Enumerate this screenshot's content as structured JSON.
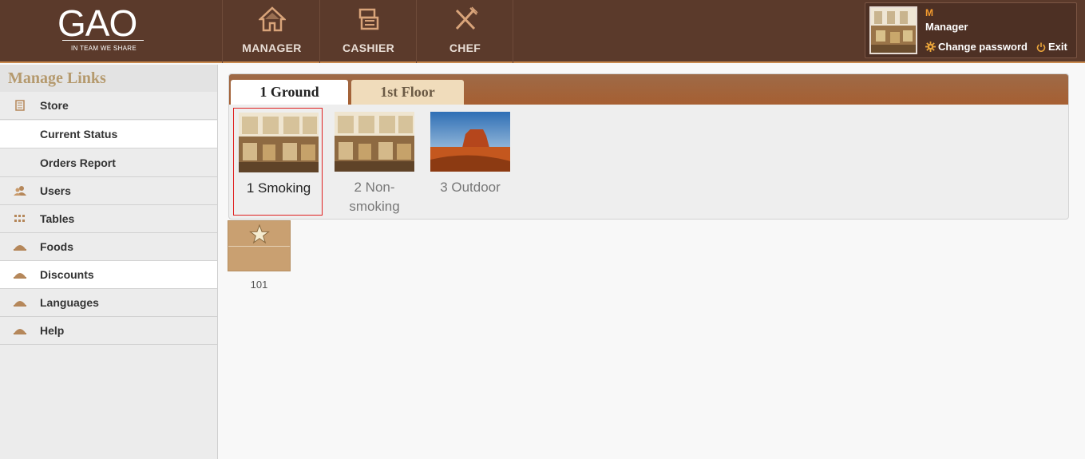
{
  "header": {
    "logo_text": "GAO",
    "logo_tagline": "IN TEAM WE SHARE",
    "nav": [
      {
        "label": "MANAGER",
        "icon": "home-icon"
      },
      {
        "label": "CASHIER",
        "icon": "cash-register-icon"
      },
      {
        "label": "CHEF",
        "icon": "fork-knife-icon"
      }
    ],
    "user": {
      "initial": "M",
      "name": "Manager",
      "change_password": "Change password",
      "exit": "Exit"
    }
  },
  "sidebar": {
    "title": "Manage Links",
    "items": [
      {
        "label": "Store",
        "icon": "store-icon"
      },
      {
        "label": "Current Status",
        "icon": ""
      },
      {
        "label": "Orders Report",
        "icon": ""
      },
      {
        "label": "Users",
        "icon": "users-icon"
      },
      {
        "label": "Tables",
        "icon": "tables-icon"
      },
      {
        "label": "Foods",
        "icon": "cloche-icon"
      },
      {
        "label": "Discounts",
        "icon": "cloche-icon"
      },
      {
        "label": "Languages",
        "icon": "cloche-icon"
      },
      {
        "label": "Help",
        "icon": "cloche-icon"
      }
    ]
  },
  "main": {
    "tabs": [
      {
        "label": "1 Ground",
        "active": true
      },
      {
        "label": "1st Floor",
        "active": false
      }
    ],
    "areas": [
      {
        "label": "1 Smoking",
        "selected": true
      },
      {
        "label": "2 Non-smoking",
        "selected": false
      },
      {
        "label": "3 Outdoor",
        "selected": false
      }
    ],
    "tables": [
      {
        "label": "101",
        "icon": "star-icon"
      }
    ]
  },
  "colors": {
    "header_bg": "#5b3a2b",
    "accent_orange": "#f29a2e",
    "tab_bar": "#a0633a",
    "table_tile": "#c9a071",
    "selection_border": "#e02020"
  }
}
